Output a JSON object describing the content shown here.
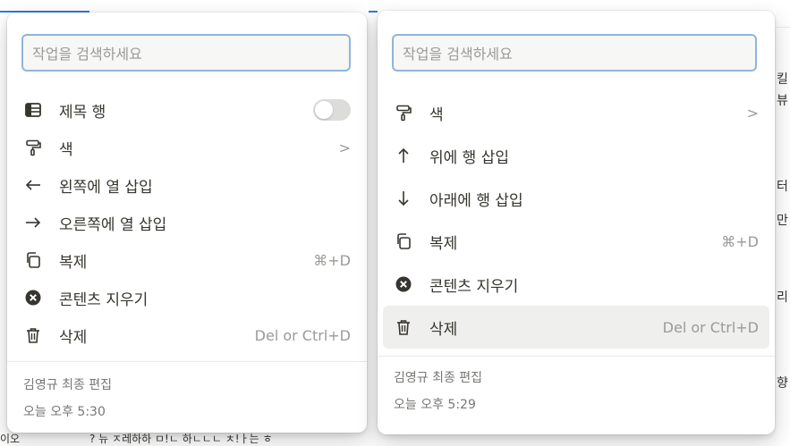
{
  "search": {
    "placeholder": "작업을 검색하세요"
  },
  "left_menu": {
    "items": [
      {
        "icon": "table-header-icon",
        "label": "제목 행",
        "control": "toggle-off"
      },
      {
        "icon": "paint-roller-icon",
        "label": "색",
        "chevron": ">"
      },
      {
        "icon": "arrow-left-icon",
        "label": "왼쪽에 열 삽입"
      },
      {
        "icon": "arrow-right-icon",
        "label": "오른쪽에 열 삽입"
      },
      {
        "icon": "duplicate-icon",
        "label": "복제",
        "shortcut": "⌘+D"
      },
      {
        "icon": "clear-contents-icon",
        "label": "콘텐츠 지우기"
      },
      {
        "icon": "trash-icon",
        "label": "삭제",
        "shortcut": "Del or Ctrl+D"
      }
    ],
    "footer": {
      "editor": "김영규 최종 편집",
      "time": "오늘 오후 5:30"
    }
  },
  "right_menu": {
    "items": [
      {
        "icon": "paint-roller-icon",
        "label": "색",
        "chevron": ">"
      },
      {
        "icon": "arrow-up-icon",
        "label": "위에 행 삽입"
      },
      {
        "icon": "arrow-down-icon",
        "label": "아래에 행 삽입"
      },
      {
        "icon": "duplicate-icon",
        "label": "복제",
        "shortcut": "⌘+D"
      },
      {
        "icon": "clear-contents-icon",
        "label": "콘텐츠 지우기"
      },
      {
        "icon": "trash-icon",
        "label": "삭제",
        "shortcut": "Del or Ctrl+D",
        "state": "hovered"
      }
    ],
    "footer": {
      "editor": "김영규 최종 편집",
      "time": "오늘 오후 5:29"
    }
  },
  "background": {
    "right_edge_chars": [
      "킬",
      "뷰",
      "터",
      "만",
      "리",
      "향"
    ],
    "bottom_fragments": [
      "이오",
      "? 뉴 ㅈ레하하 ㅁ!ㄴ 하ㄴㄴㄴ ㅊ!ㅏ는 ㅎ"
    ]
  },
  "colors": {
    "search_border": "#8fb6dc",
    "hover_bg": "#efefed",
    "muted_text": "#9b9a97",
    "text": "#37352f",
    "toggle_off": "#dcdcda"
  }
}
